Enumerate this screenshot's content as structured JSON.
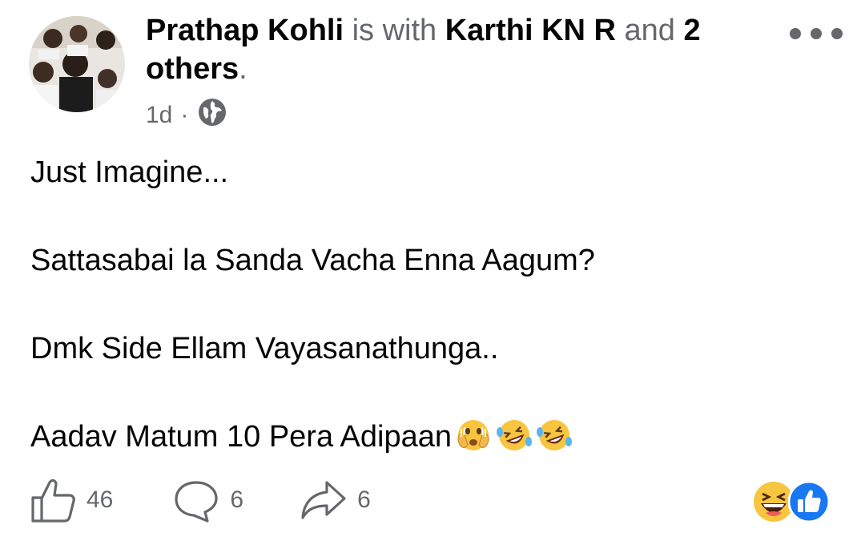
{
  "post": {
    "author": "Prathap Kohli",
    "with_text": "is with",
    "tagged": "Karthi KN R",
    "and_text": "and",
    "others": "2 others",
    "period": ".",
    "time": "1d",
    "separator": "·",
    "privacy_icon": "globe-icon",
    "more_icon": "more-horizontal-icon",
    "lines": [
      "Just Imagine...",
      "Sattasabai la Sanda Vacha Enna Aagum?",
      "Dmk Side Ellam Vayasanathunga..",
      "Aadav Matum 10 Pera Adipaan"
    ],
    "emojis": [
      "face-with-open-eyes-and-hand-over-mouth",
      "rolling-on-the-floor-laughing",
      "rolling-on-the-floor-laughing"
    ]
  },
  "actions": {
    "like_count": "46",
    "comment_count": "6",
    "share_count": "6"
  },
  "reactions": [
    "haha-icon",
    "like-icon"
  ],
  "colors": {
    "text": "#050505",
    "muted": "#65676b",
    "like_blue": "#1877f2",
    "emoji_yellow": "#f7c53f"
  }
}
